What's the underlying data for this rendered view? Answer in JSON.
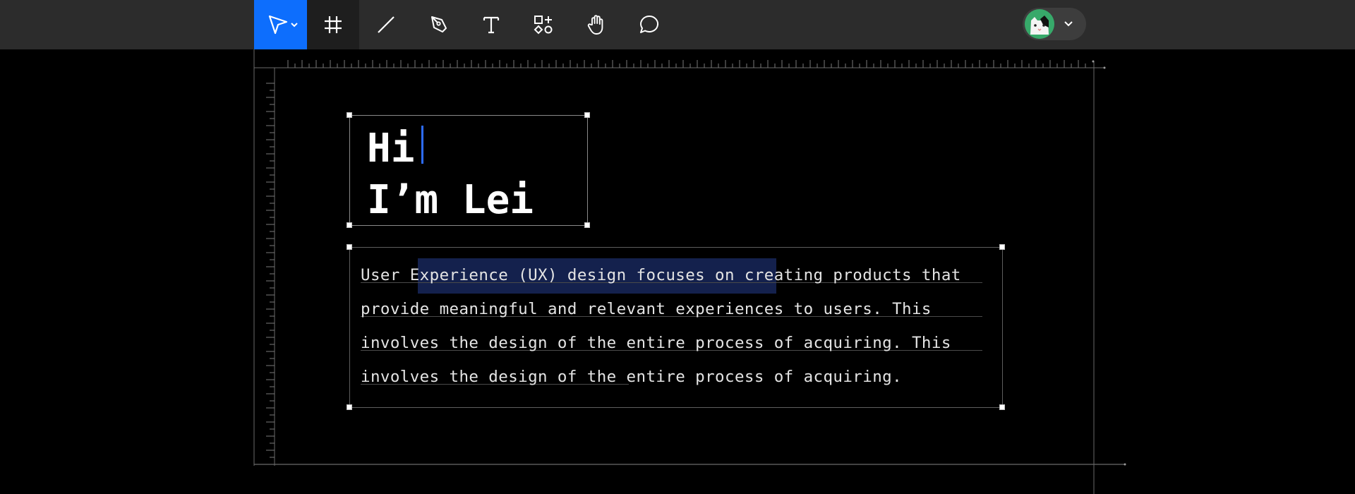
{
  "toolbar": {
    "tools": [
      {
        "name": "move-tool",
        "icon": "cursor-arrow-icon",
        "active": true
      },
      {
        "name": "frame-tool",
        "icon": "hash-frame-icon"
      },
      {
        "name": "line-tool",
        "icon": "line-icon"
      },
      {
        "name": "pen-tool",
        "icon": "pen-nib-icon"
      },
      {
        "name": "text-tool",
        "icon": "text-t-icon"
      },
      {
        "name": "components-tool",
        "icon": "shapes-icon"
      },
      {
        "name": "hand-tool",
        "icon": "hand-icon"
      },
      {
        "name": "comment-tool",
        "icon": "comment-bubble-icon"
      }
    ],
    "user": {
      "avatar": "cat-avatar-icon",
      "menu_icon": "chevron-down-icon"
    }
  },
  "canvas": {
    "heading": {
      "lines": [
        "Hi",
        "I’m Lei"
      ]
    },
    "paragraph": {
      "lines": [
        "User Experience (UX) design focuses on creating products that",
        "provide meaningful and relevant experiences to users. This",
        "involves the design of the entire process of acquiring. This",
        "involves the design of the entire process of acquiring."
      ]
    }
  },
  "colors": {
    "toolbar_bg": "#2c2c2c",
    "accent": "#0d6efd",
    "canvas_bg": "#000000",
    "selection": "#14214d",
    "caret": "#2d6cff"
  }
}
